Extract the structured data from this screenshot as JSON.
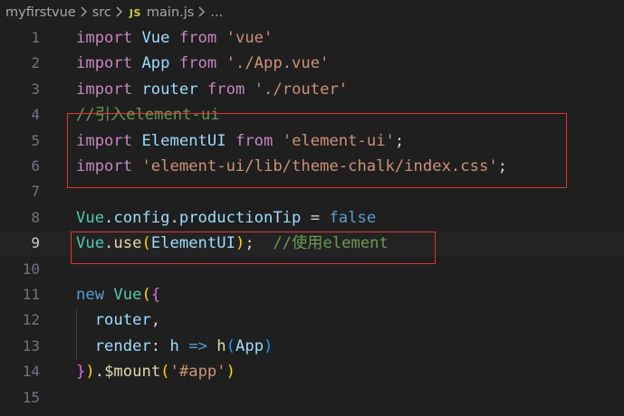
{
  "breadcrumb": {
    "items": [
      "myfirstvue",
      "src"
    ],
    "file_badge": "JS",
    "file": "main.js",
    "ellipsis": "..."
  },
  "colors": {
    "background": "#1f1f1f",
    "keyword": "#c586c0",
    "string": "#ce9178",
    "comment": "#6a9955",
    "annotation_box": "#e03434"
  },
  "editor": {
    "current_line": 9,
    "lines": [
      {
        "n": "1",
        "t": [
          [
            "import",
            "kw"
          ],
          [
            " ",
            ""
          ],
          [
            "Vue",
            "id"
          ],
          [
            " ",
            ""
          ],
          [
            "from",
            "kw"
          ],
          [
            " ",
            ""
          ],
          [
            "'vue'",
            "str"
          ]
        ]
      },
      {
        "n": "2",
        "t": [
          [
            "import",
            "kw"
          ],
          [
            " ",
            ""
          ],
          [
            "App",
            "id"
          ],
          [
            " ",
            ""
          ],
          [
            "from",
            "kw"
          ],
          [
            " ",
            ""
          ],
          [
            "'./App.vue'",
            "str"
          ]
        ]
      },
      {
        "n": "3",
        "t": [
          [
            "import",
            "kw"
          ],
          [
            " ",
            ""
          ],
          [
            "router",
            "id"
          ],
          [
            " ",
            ""
          ],
          [
            "from",
            "kw"
          ],
          [
            " ",
            ""
          ],
          [
            "'./router'",
            "str"
          ]
        ]
      },
      {
        "n": "4",
        "t": [
          [
            "//引入element-ui",
            "cm"
          ]
        ]
      },
      {
        "n": "5",
        "t": [
          [
            "import",
            "kw"
          ],
          [
            " ",
            ""
          ],
          [
            "ElementUI",
            "id"
          ],
          [
            " ",
            ""
          ],
          [
            "from",
            "kw"
          ],
          [
            " ",
            ""
          ],
          [
            "'element-ui'",
            "str"
          ],
          [
            ";",
            "op"
          ]
        ]
      },
      {
        "n": "6",
        "t": [
          [
            "import",
            "kw"
          ],
          [
            " ",
            ""
          ],
          [
            "'element-ui/lib/theme-chalk/index.css'",
            "str"
          ],
          [
            ";",
            "op"
          ]
        ]
      },
      {
        "n": "7",
        "t": []
      },
      {
        "n": "8",
        "t": [
          [
            "Vue",
            "cls"
          ],
          [
            ".",
            "op"
          ],
          [
            "config",
            "id"
          ],
          [
            ".",
            "op"
          ],
          [
            "productionTip",
            "id"
          ],
          [
            " = ",
            "op"
          ],
          [
            "false",
            "bool"
          ]
        ]
      },
      {
        "n": "9",
        "t": [
          [
            "Vue",
            "cls"
          ],
          [
            ".",
            "op"
          ],
          [
            "use",
            "fn"
          ],
          [
            "(",
            "b1"
          ],
          [
            "ElementUI",
            "id"
          ],
          [
            ")",
            "b1"
          ],
          [
            ";",
            "op"
          ],
          [
            "  ",
            ""
          ],
          [
            "//使用element",
            "cm"
          ]
        ]
      },
      {
        "n": "10",
        "t": []
      },
      {
        "n": "11",
        "t": [
          [
            "new",
            "bool"
          ],
          [
            " ",
            ""
          ],
          [
            "Vue",
            "cls"
          ],
          [
            "(",
            "b1"
          ],
          [
            "{",
            "b2"
          ]
        ]
      },
      {
        "n": "12",
        "t": [
          [
            "  ",
            ""
          ],
          [
            "router",
            "id"
          ],
          [
            ",",
            "op"
          ]
        ]
      },
      {
        "n": "13",
        "t": [
          [
            "  ",
            ""
          ],
          [
            "render",
            "id"
          ],
          [
            ": ",
            "op"
          ],
          [
            "h",
            "id"
          ],
          [
            " ",
            ""
          ],
          [
            "=>",
            "bool"
          ],
          [
            " ",
            ""
          ],
          [
            "h",
            "fn"
          ],
          [
            "(",
            "b3"
          ],
          [
            "App",
            "id"
          ],
          [
            ")",
            "b3"
          ]
        ]
      },
      {
        "n": "14",
        "t": [
          [
            "}",
            "b2"
          ],
          [
            ")",
            "b1"
          ],
          [
            ".",
            "op"
          ],
          [
            "$mount",
            "fn"
          ],
          [
            "(",
            "b1"
          ],
          [
            "'#app'",
            "str"
          ],
          [
            ")",
            "b1"
          ]
        ]
      },
      {
        "n": "15",
        "t": []
      }
    ]
  }
}
